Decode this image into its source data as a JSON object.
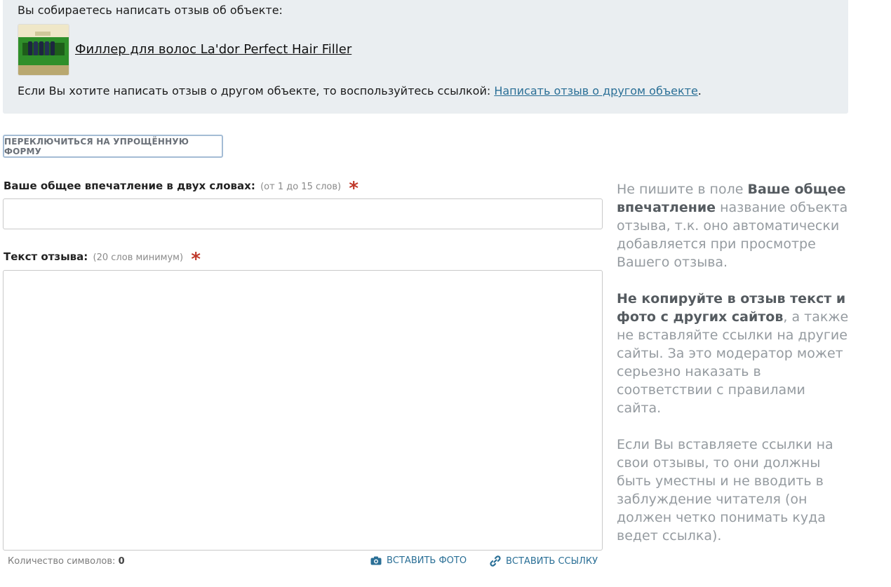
{
  "object": {
    "intro": "Вы собираетесь написать отзыв об объекте:",
    "name": "Филлер для волос La'dor Perfect Hair Filler",
    "other_prefix": "Если Вы хотите написать отзыв о другом объекте, то воспользуйтесь ссылкой: ",
    "other_link": "Написать отзыв о другом объекте",
    "other_suffix": "."
  },
  "switch_button": "ПЕРЕКЛЮЧИТЬСЯ НА УПРОЩЁННУЮ ФОРМУ",
  "impression": {
    "label": "Ваше общее впечатление в двух словах:",
    "hint": "(от 1 до 15 слов)",
    "required": "*",
    "value": ""
  },
  "review": {
    "label": "Текст отзыва:",
    "hint": "(20 слов минимум)",
    "required": "*",
    "value": ""
  },
  "counter": {
    "label": "Количество символов:",
    "value": "0"
  },
  "toolbar": {
    "insert_photo": "ВСТАВИТЬ ФОТО",
    "insert_link": "ВСТАВИТЬ ССЫЛКУ"
  },
  "aside": {
    "p1_pre": "Не пишите в поле ",
    "p1_bold": "Ваше общее впечатление",
    "p1_post": " название объекта отзыва, т.к. оно автоматически добавляется при просмотре Вашего отзыва.",
    "p2_bold": "Не копируйте в отзыв текст и фото с других сайтов",
    "p2_post": ", а также не вставляйте ссылки на другие сайты. За это модератор может серьезно наказать в соответствии с правилами сайта.",
    "p3": "Если Вы вставляете ссылки на свои отзывы, то они должны быть уместны и не вводить в заблуждение читателя (он должен четко понимать куда ведет ссылка)."
  },
  "colors": {
    "link": "#2a6f96",
    "required": "#c0392b",
    "panel_bg": "#eaeef1",
    "aside_text": "#959ba0"
  },
  "icons": [
    "camera-icon",
    "link-icon"
  ]
}
